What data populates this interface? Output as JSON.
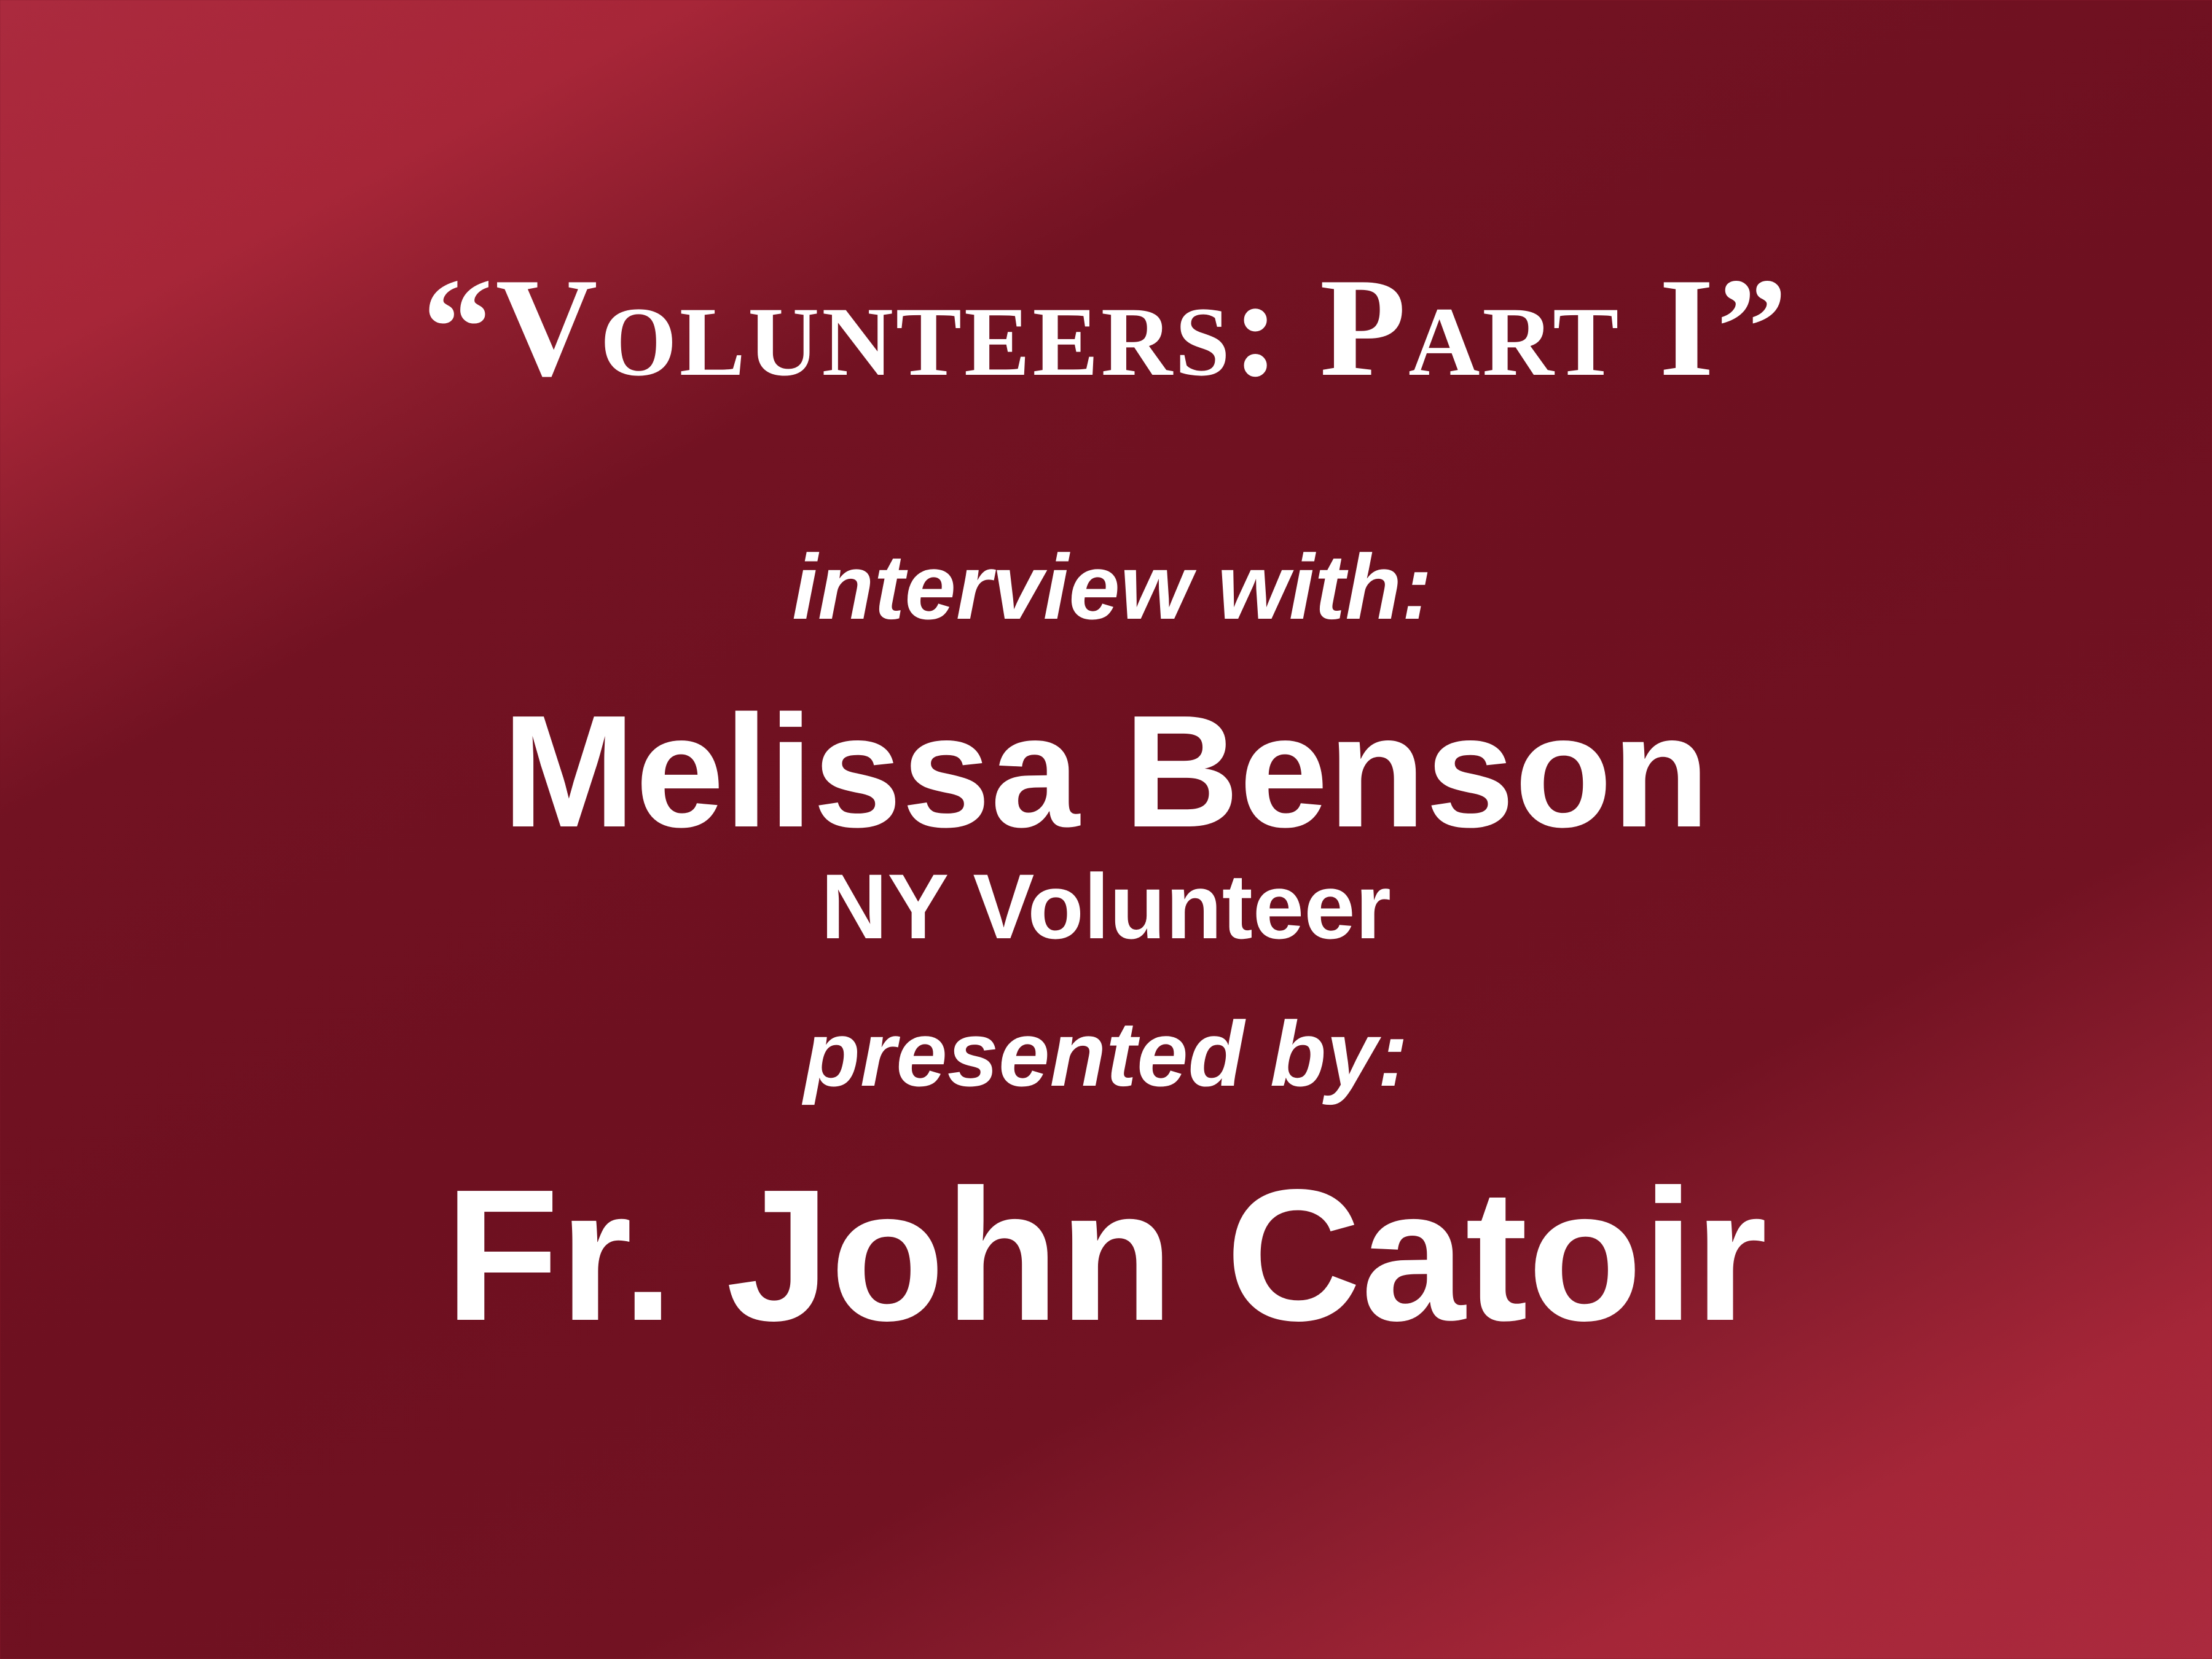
{
  "slide": {
    "title": "“Volunteers:  Part I”",
    "interview_label": "interview with:",
    "guest_name": "Melissa Benson",
    "guest_role": "NY Volunteer",
    "presented_label": "presented by:",
    "presenter_name": "Fr. John Catoir"
  },
  "colors": {
    "background_dark": "#6e1020",
    "background_light": "#ab2a3e",
    "text": "#ffffff"
  }
}
